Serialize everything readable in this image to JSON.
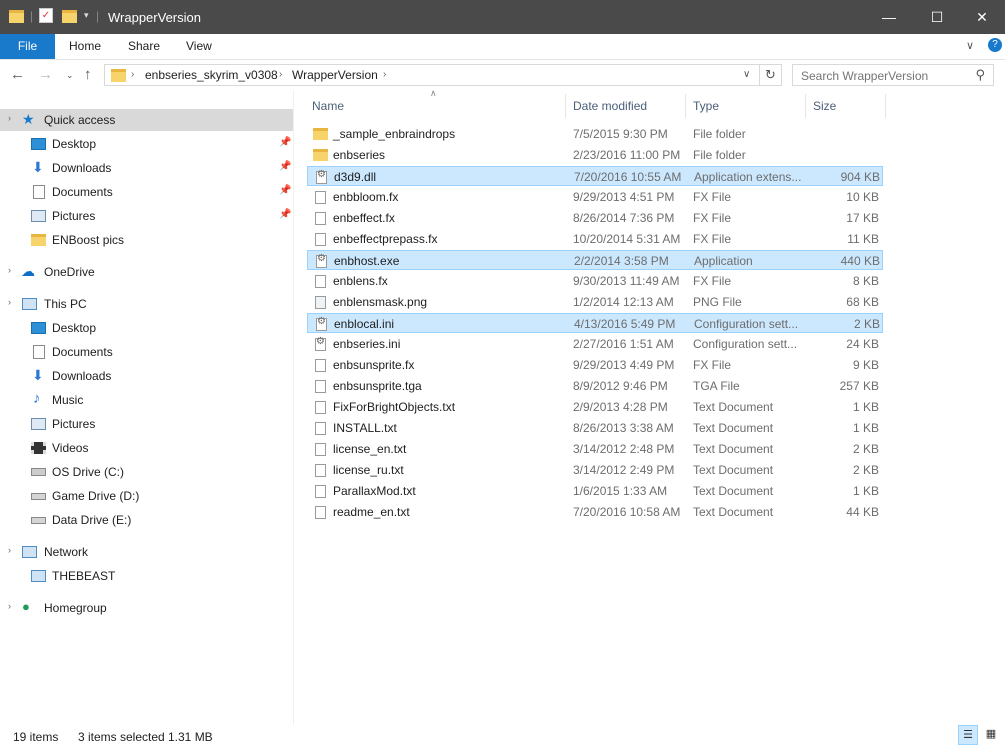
{
  "window": {
    "title": "WrapperVersion",
    "controls": {
      "minimize": "—",
      "maximize": "☐",
      "close": "✕"
    },
    "accent": "#1979ca"
  },
  "ribbon": {
    "tabs": [
      "File",
      "Home",
      "Share",
      "View"
    ]
  },
  "address": {
    "crumbs": [
      "enbseries_skyrim_v0308",
      "WrapperVersion"
    ],
    "search_placeholder": "Search WrapperVersion"
  },
  "sidebar": {
    "quick_access": "Quick access",
    "qa_items": [
      "Desktop",
      "Downloads",
      "Documents",
      "Pictures",
      "ENBoost pics"
    ],
    "onedrive": "OneDrive",
    "this_pc": "This PC",
    "pc_items": [
      "Desktop",
      "Documents",
      "Downloads",
      "Music",
      "Pictures",
      "Videos",
      "OS Drive (C:)",
      "Game Drive (D:)",
      "Data Drive (E:)"
    ],
    "network": "Network",
    "network_items": [
      "THEBEAST"
    ],
    "homegroup": "Homegroup"
  },
  "columns": {
    "name": "Name",
    "date": "Date modified",
    "type": "Type",
    "size": "Size"
  },
  "files": [
    {
      "name": "_sample_enbraindrops",
      "date": "7/5/2015 9:30 PM",
      "type": "File folder",
      "size": "",
      "icon": "folder",
      "selected": false
    },
    {
      "name": "enbseries",
      "date": "2/23/2016 11:00 PM",
      "type": "File folder",
      "size": "",
      "icon": "folder",
      "selected": false
    },
    {
      "name": "d3d9.dll",
      "date": "7/20/2016 10:55 AM",
      "type": "Application extens...",
      "size": "904 KB",
      "icon": "gear",
      "selected": true
    },
    {
      "name": "enbbloom.fx",
      "date": "9/29/2013 4:51 PM",
      "type": "FX File",
      "size": "10 KB",
      "icon": "file",
      "selected": false
    },
    {
      "name": "enbeffect.fx",
      "date": "8/26/2014 7:36 PM",
      "type": "FX File",
      "size": "17 KB",
      "icon": "file",
      "selected": false
    },
    {
      "name": "enbeffectprepass.fx",
      "date": "10/20/2014 5:31 AM",
      "type": "FX File",
      "size": "11 KB",
      "icon": "file",
      "selected": false
    },
    {
      "name": "enbhost.exe",
      "date": "2/2/2014 3:58 PM",
      "type": "Application",
      "size": "440 KB",
      "icon": "gear",
      "selected": true
    },
    {
      "name": "enblens.fx",
      "date": "9/30/2013 11:49 AM",
      "type": "FX File",
      "size": "8 KB",
      "icon": "file",
      "selected": false
    },
    {
      "name": "enblensmask.png",
      "date": "1/2/2014 12:13 AM",
      "type": "PNG File",
      "size": "68 KB",
      "icon": "img",
      "selected": false
    },
    {
      "name": "enblocal.ini",
      "date": "4/13/2016 5:49 PM",
      "type": "Configuration sett...",
      "size": "2 KB",
      "icon": "gear",
      "selected": true
    },
    {
      "name": "enbseries.ini",
      "date": "2/27/2016 1:51 AM",
      "type": "Configuration sett...",
      "size": "24 KB",
      "icon": "gear",
      "selected": false
    },
    {
      "name": "enbsunsprite.fx",
      "date": "9/29/2013 4:49 PM",
      "type": "FX File",
      "size": "9 KB",
      "icon": "file",
      "selected": false
    },
    {
      "name": "enbsunsprite.tga",
      "date": "8/9/2012 9:46 PM",
      "type": "TGA File",
      "size": "257 KB",
      "icon": "file",
      "selected": false
    },
    {
      "name": "FixForBrightObjects.txt",
      "date": "2/9/2013 4:28 PM",
      "type": "Text Document",
      "size": "1 KB",
      "icon": "file",
      "selected": false
    },
    {
      "name": "INSTALL.txt",
      "date": "8/26/2013 3:38 AM",
      "type": "Text Document",
      "size": "1 KB",
      "icon": "file",
      "selected": false
    },
    {
      "name": "license_en.txt",
      "date": "3/14/2012 2:48 PM",
      "type": "Text Document",
      "size": "2 KB",
      "icon": "file",
      "selected": false
    },
    {
      "name": "license_ru.txt",
      "date": "3/14/2012 2:49 PM",
      "type": "Text Document",
      "size": "2 KB",
      "icon": "file",
      "selected": false
    },
    {
      "name": "ParallaxMod.txt",
      "date": "1/6/2015 1:33 AM",
      "type": "Text Document",
      "size": "1 KB",
      "icon": "file",
      "selected": false
    },
    {
      "name": "readme_en.txt",
      "date": "7/20/2016 10:58 AM",
      "type": "Text Document",
      "size": "44 KB",
      "icon": "file",
      "selected": false
    }
  ],
  "status": {
    "item_count": "19 items",
    "selection": "3 items selected",
    "selection_size": "1.31 MB"
  }
}
